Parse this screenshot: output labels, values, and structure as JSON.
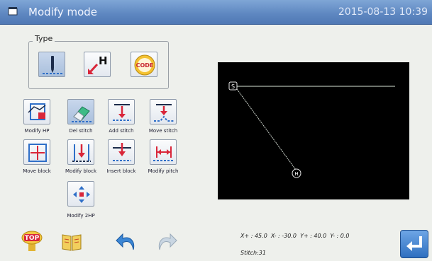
{
  "titlebar": {
    "title": "Modify mode",
    "datetime": "2015-08-13 10:39"
  },
  "type_panel": {
    "label": "Type",
    "code_label": "CODE"
  },
  "functions": [
    {
      "label": "Modify HP"
    },
    {
      "label": "Del stitch"
    },
    {
      "label": "Add stitch"
    },
    {
      "label": "Move stitch"
    },
    {
      "label": "Move block"
    },
    {
      "label": "Modify block"
    },
    {
      "label": "Insert block"
    },
    {
      "label": "Modify pitch"
    },
    {
      "label": "Modify 2HP"
    }
  ],
  "canvas": {
    "start_marker": "S",
    "home_marker": "H"
  },
  "status": {
    "coords": "X+ : 45.0  X- : -30.0  Y+ : 40.0  Y- : 0.0",
    "stitch": "Stitch:31"
  },
  "bottom": {
    "top_label": "TOP"
  },
  "colors": {
    "titlebar": "#5d86c0",
    "accent_red": "#d9263a",
    "accent_blue": "#2f6fc8",
    "canvas_line": "#d8e6d6"
  }
}
